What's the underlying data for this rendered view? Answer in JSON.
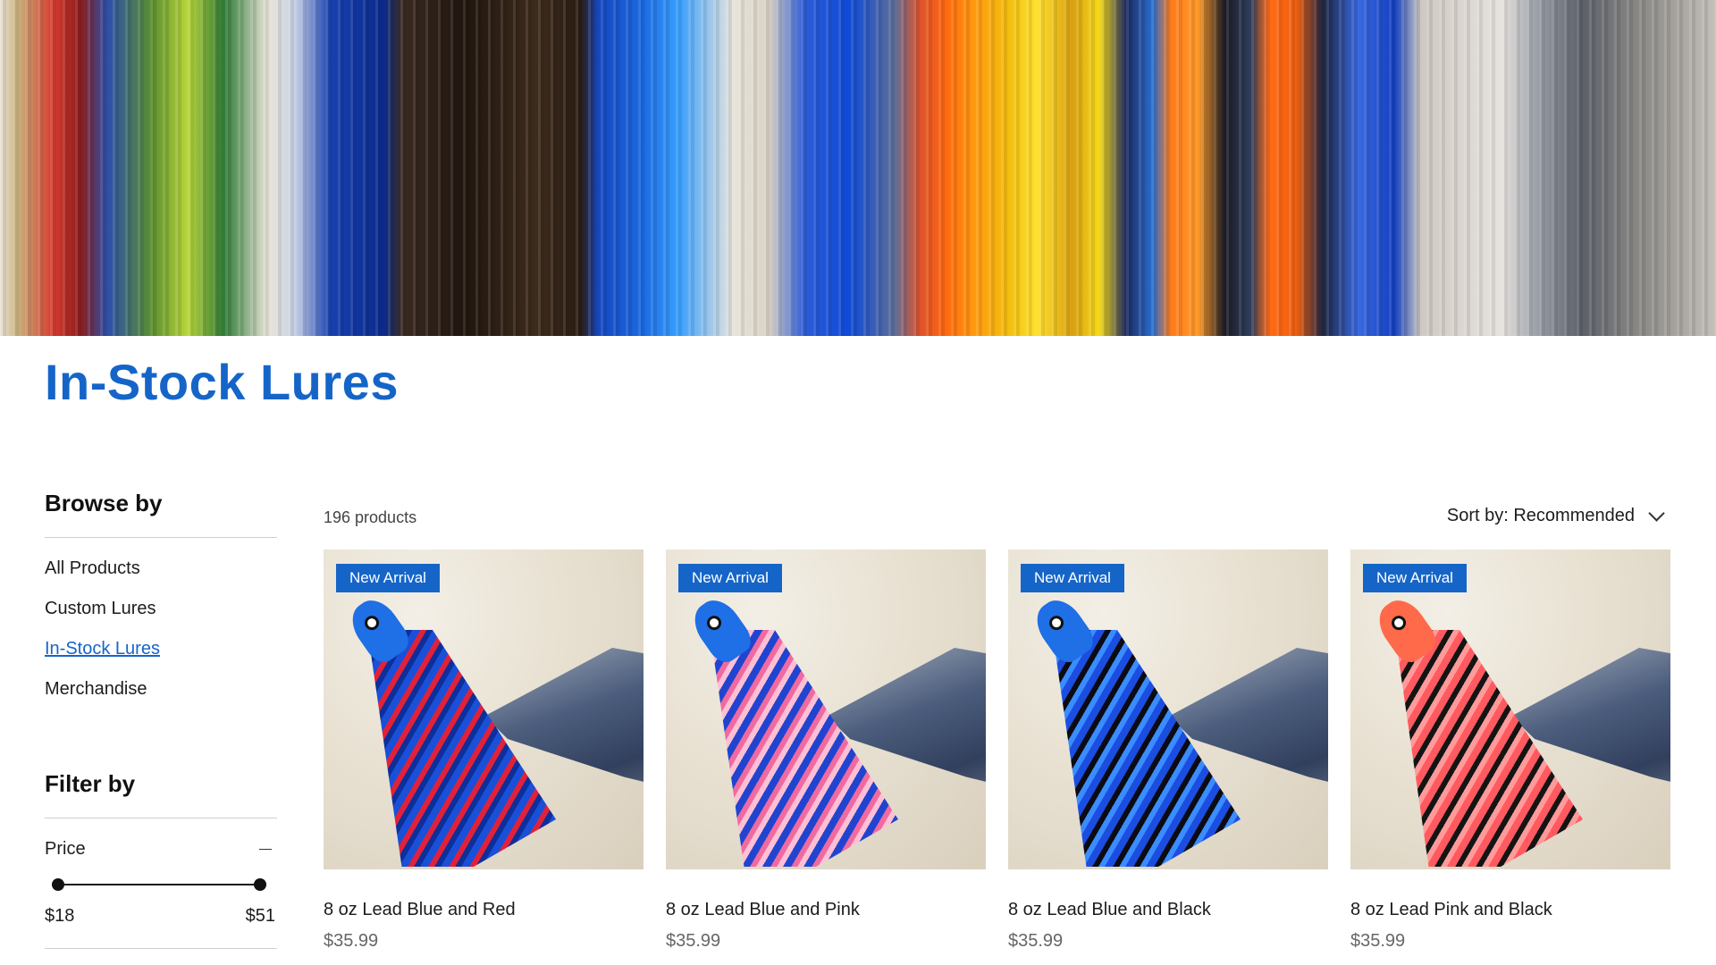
{
  "page": {
    "title": "In-Stock Lures"
  },
  "sidebar": {
    "browse_heading": "Browse by",
    "browse_items": [
      "All Products",
      "Custom Lures",
      "In-Stock Lures",
      "Merchandise"
    ],
    "active_item": "In-Stock Lures",
    "filter_heading": "Filter by",
    "price": {
      "label": "Price",
      "min": "$18",
      "max": "$51",
      "range_selected": [
        0,
        1
      ]
    }
  },
  "listing": {
    "count": "196 products",
    "sort_label": "Sort by: Recommended",
    "products": [
      {
        "badge": "New Arrival",
        "name": "8 oz Lead Blue and Red",
        "price": "$35.99",
        "head_color": "#1f6fe6",
        "skirt_colors": [
          "#1a4fd8",
          "#e0213a",
          "#0d2f9a"
        ]
      },
      {
        "badge": "New Arrival",
        "name": "8 oz Lead Blue and Pink",
        "price": "$35.99",
        "head_color": "#1f6fe6",
        "skirt_colors": [
          "#2144d0",
          "#f06aa0",
          "#ffc0d6"
        ]
      },
      {
        "badge": "New Arrival",
        "name": "8 oz Lead Blue and Black",
        "price": "$35.99",
        "head_color": "#1f6fe6",
        "skirt_colors": [
          "#1b4ee0",
          "#0b0b14",
          "#3a8cff"
        ]
      },
      {
        "badge": "New Arrival",
        "name": "8 oz Lead Pink and Black",
        "price": "$35.99",
        "head_color": "#ff6a4a",
        "skirt_colors": [
          "#ff5a60",
          "#141414",
          "#ff9a9a"
        ]
      }
    ]
  }
}
